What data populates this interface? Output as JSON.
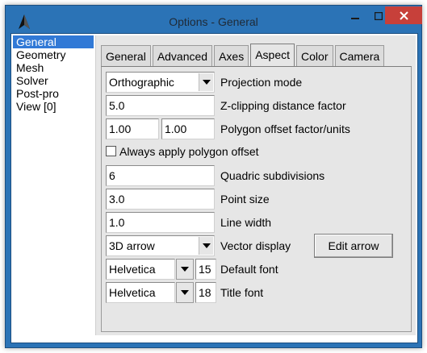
{
  "window": {
    "title": "Options - General"
  },
  "sidebar": {
    "items": [
      {
        "label": "General",
        "selected": true
      },
      {
        "label": "Geometry",
        "selected": false
      },
      {
        "label": "Mesh",
        "selected": false
      },
      {
        "label": "Solver",
        "selected": false
      },
      {
        "label": "Post-pro",
        "selected": false
      },
      {
        "label": "View [0]",
        "selected": false
      }
    ]
  },
  "tabs": [
    {
      "label": "General",
      "active": false
    },
    {
      "label": "Advanced",
      "active": false
    },
    {
      "label": "Axes",
      "active": false
    },
    {
      "label": "Aspect",
      "active": true
    },
    {
      "label": "Color",
      "active": false
    },
    {
      "label": "Camera",
      "active": false
    }
  ],
  "aspect": {
    "projection": {
      "value": "Orthographic",
      "label": "Projection mode"
    },
    "zclip": {
      "value": "5.0",
      "label": "Z-clipping distance factor"
    },
    "polygon_offset": {
      "factor": "1.00",
      "units": "1.00",
      "label": "Polygon offset factor/units"
    },
    "always_offset": {
      "checked": false,
      "label": "Always apply polygon offset"
    },
    "quadric": {
      "value": "6",
      "label": "Quadric subdivisions"
    },
    "point_size": {
      "value": "3.0",
      "label": "Point size"
    },
    "line_width": {
      "value": "1.0",
      "label": "Line width"
    },
    "vector_display": {
      "value": "3D arrow",
      "label": "Vector display",
      "button": "Edit arrow"
    },
    "default_font": {
      "family": "Helvetica",
      "size": "15",
      "label": "Default font"
    },
    "title_font": {
      "family": "Helvetica",
      "size": "18",
      "label": "Title font"
    }
  },
  "colors": {
    "titlebar": "#2b73b6",
    "close_button": "#c7403a",
    "selection": "#3179d6"
  }
}
